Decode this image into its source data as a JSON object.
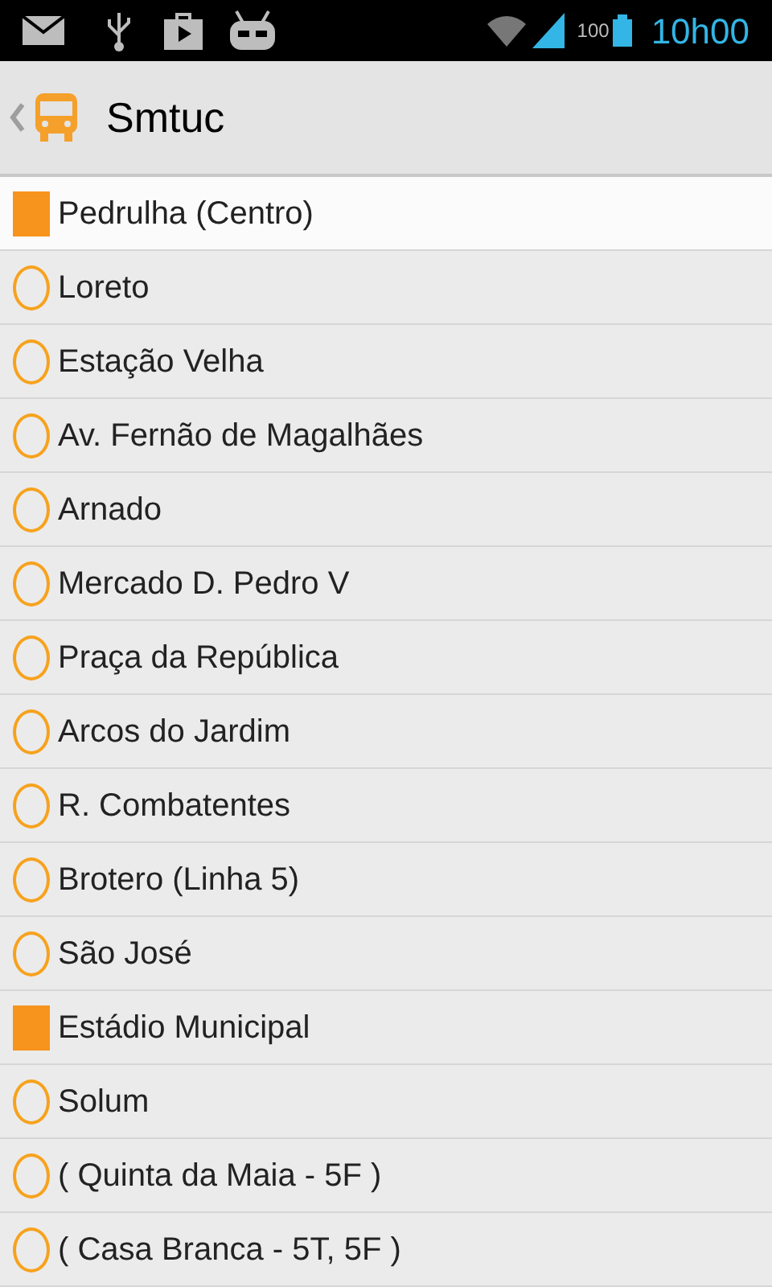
{
  "status_bar": {
    "battery": "100",
    "time": "10h00"
  },
  "action_bar": {
    "title": "Smtuc"
  },
  "stops": [
    {
      "name": "Pedrulha (Centro)",
      "kind": "terminal",
      "selected": true
    },
    {
      "name": "Loreto",
      "kind": "stop",
      "selected": false
    },
    {
      "name": "Estação Velha",
      "kind": "stop",
      "selected": false
    },
    {
      "name": "Av. Fernão de Magalhães",
      "kind": "stop",
      "selected": false
    },
    {
      "name": "Arnado",
      "kind": "stop",
      "selected": false
    },
    {
      "name": "Mercado D. Pedro V",
      "kind": "stop",
      "selected": false
    },
    {
      "name": "Praça da República",
      "kind": "stop",
      "selected": false
    },
    {
      "name": "Arcos do Jardim",
      "kind": "stop",
      "selected": false
    },
    {
      "name": "R. Combatentes",
      "kind": "stop",
      "selected": false
    },
    {
      "name": "Brotero (Linha 5)",
      "kind": "stop",
      "selected": false
    },
    {
      "name": "São José",
      "kind": "stop",
      "selected": false
    },
    {
      "name": "Estádio Municipal",
      "kind": "terminal",
      "selected": false
    },
    {
      "name": "Solum",
      "kind": "stop",
      "selected": false
    },
    {
      "name": "( Quinta da Maia - 5F )",
      "kind": "stop",
      "selected": false
    },
    {
      "name": "( Casa Branca - 5T, 5F )",
      "kind": "stop",
      "selected": false
    }
  ]
}
